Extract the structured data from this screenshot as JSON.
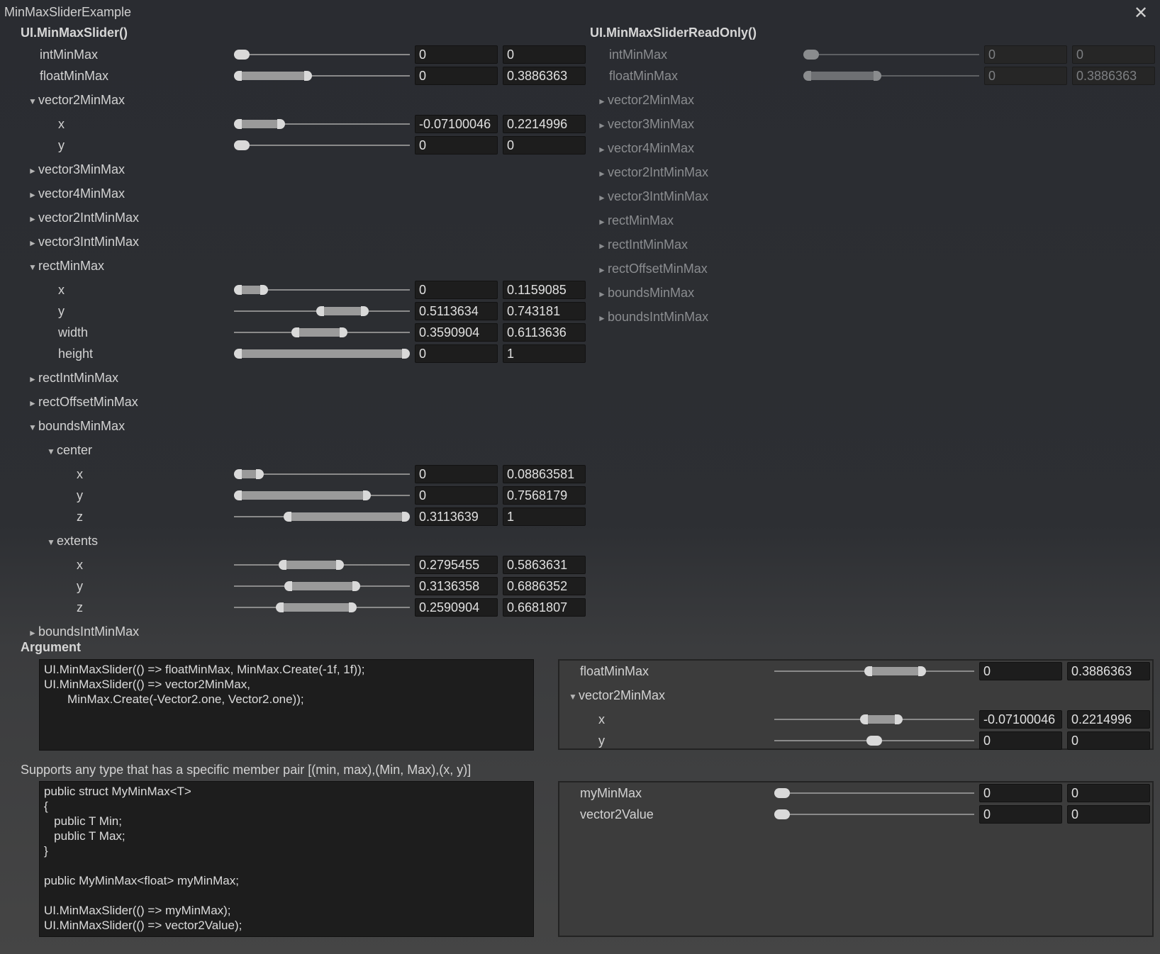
{
  "window": {
    "title": "MinMaxSliderExample"
  },
  "left": {
    "header": "UI.MinMaxSlider()",
    "rows": [
      {
        "label": "intMinMax",
        "indent": 0,
        "slider": [
          0,
          0.0
        ],
        "min": "0",
        "max": "0"
      },
      {
        "label": "floatMinMax",
        "indent": 0,
        "slider": [
          0,
          0.3886363
        ],
        "min": "0",
        "max": "0.3886363"
      },
      {
        "label": "vector2MinMax",
        "indent": 0,
        "arrow": "▼"
      },
      {
        "label": "x",
        "indent": 1,
        "slider": [
          0,
          0.2214996
        ],
        "min": "-0.07100046",
        "max": "0.2214996"
      },
      {
        "label": "y",
        "indent": 1,
        "slider": [
          0,
          0.0
        ],
        "min": "0",
        "max": "0"
      },
      {
        "label": "vector3MinMax",
        "indent": 0,
        "arrow": "►"
      },
      {
        "label": "vector4MinMax",
        "indent": 0,
        "arrow": "►"
      },
      {
        "label": "vector2IntMinMax",
        "indent": 0,
        "arrow": "►"
      },
      {
        "label": "vector3IntMinMax",
        "indent": 0,
        "arrow": "►"
      },
      {
        "label": "rectMinMax",
        "indent": 0,
        "arrow": "▼"
      },
      {
        "label": "x",
        "indent": 1,
        "slider": [
          0,
          0.1159085
        ],
        "min": "0",
        "max": "0.1159085"
      },
      {
        "label": "y",
        "indent": 1,
        "slider": [
          0.5113634,
          0.743181
        ],
        "min": "0.5113634",
        "max": "0.743181"
      },
      {
        "label": "width",
        "indent": 1,
        "slider": [
          0.3590904,
          0.6113636
        ],
        "min": "0.3590904",
        "max": "0.6113636"
      },
      {
        "label": "height",
        "indent": 1,
        "slider": [
          0,
          1
        ],
        "min": "0",
        "max": "1"
      },
      {
        "label": "rectIntMinMax",
        "indent": 0,
        "arrow": "►"
      },
      {
        "label": "rectOffsetMinMax",
        "indent": 0,
        "arrow": "►"
      },
      {
        "label": "boundsMinMax",
        "indent": 0,
        "arrow": "▼"
      },
      {
        "label": "center",
        "indent": 1,
        "arrow": "▼"
      },
      {
        "label": "x",
        "indent": 2,
        "slider": [
          0,
          0.08863581
        ],
        "min": "0",
        "max": "0.08863581"
      },
      {
        "label": "y",
        "indent": 2,
        "slider": [
          0,
          0.7568179
        ],
        "min": "0",
        "max": "0.7568179"
      },
      {
        "label": "z",
        "indent": 2,
        "slider": [
          0.3113639,
          1
        ],
        "min": "0.3113639",
        "max": "1"
      },
      {
        "label": "extents",
        "indent": 1,
        "arrow": "▼"
      },
      {
        "label": "x",
        "indent": 2,
        "slider": [
          0.2795455,
          0.5863631
        ],
        "min": "0.2795455",
        "max": "0.5863631"
      },
      {
        "label": "y",
        "indent": 2,
        "slider": [
          0.3136358,
          0.6886352
        ],
        "min": "0.3136358",
        "max": "0.6886352"
      },
      {
        "label": "z",
        "indent": 2,
        "slider": [
          0.2590904,
          0.6681807
        ],
        "min": "0.2590904",
        "max": "0.6681807"
      },
      {
        "label": "boundsIntMinMax",
        "indent": 0,
        "arrow": "►"
      }
    ]
  },
  "right": {
    "header": "UI.MinMaxSliderReadOnly()",
    "rows": [
      {
        "label": "intMinMax",
        "indent": 0,
        "slider": [
          0,
          0.0
        ],
        "min": "0",
        "max": "0"
      },
      {
        "label": "floatMinMax",
        "indent": 0,
        "slider": [
          0,
          0.3886363
        ],
        "min": "0",
        "max": "0.3886363"
      },
      {
        "label": "vector2MinMax",
        "indent": 0,
        "arrow": "►"
      },
      {
        "label": "vector3MinMax",
        "indent": 0,
        "arrow": "►"
      },
      {
        "label": "vector4MinMax",
        "indent": 0,
        "arrow": "►"
      },
      {
        "label": "vector2IntMinMax",
        "indent": 0,
        "arrow": "►"
      },
      {
        "label": "vector3IntMinMax",
        "indent": 0,
        "arrow": "►"
      },
      {
        "label": "rectMinMax",
        "indent": 0,
        "arrow": "►"
      },
      {
        "label": "rectIntMinMax",
        "indent": 0,
        "arrow": "►"
      },
      {
        "label": "rectOffsetMinMax",
        "indent": 0,
        "arrow": "►"
      },
      {
        "label": "boundsMinMax",
        "indent": 0,
        "arrow": "►"
      },
      {
        "label": "boundsIntMinMax",
        "indent": 0,
        "arrow": "►"
      }
    ]
  },
  "argument": {
    "header": "Argument",
    "code": "UI.MinMaxSlider(() => floatMinMax, MinMax.Create(-1f, 1f));\nUI.MinMaxSlider(() => vector2MinMax,\n       MinMax.Create(-Vector2.one, Vector2.one));",
    "rows": [
      {
        "label": "floatMinMax",
        "indent": 0,
        "slider": [
          0.4886,
          0.7386
        ],
        "min": "0",
        "max": "0.3886363"
      },
      {
        "label": "vector2MinMax",
        "indent": 0,
        "arrow": "▼"
      },
      {
        "label": "x",
        "indent": 1,
        "slider": [
          0.4645,
          0.6107
        ],
        "min": "-0.07100046",
        "max": "0.2214996"
      },
      {
        "label": "y",
        "indent": 1,
        "slider": [
          0.5,
          0.5
        ],
        "min": "0",
        "max": "0"
      }
    ]
  },
  "support": {
    "text": "Supports any type that has a specific member pair [(min, max),(Min, Max),(x, y)]",
    "code": "public struct MyMinMax<T>\n{\n   public T Min;\n   public T Max;\n}\n\npublic MyMinMax<float> myMinMax;\n\nUI.MinMaxSlider(() => myMinMax);\nUI.MinMaxSlider(() => vector2Value);",
    "rows": [
      {
        "label": "myMinMax",
        "indent": 0,
        "slider": [
          0,
          0.0
        ],
        "min": "0",
        "max": "0"
      },
      {
        "label": "vector2Value",
        "indent": 0,
        "slider": [
          0,
          0.0
        ],
        "min": "0",
        "max": "0"
      }
    ]
  }
}
